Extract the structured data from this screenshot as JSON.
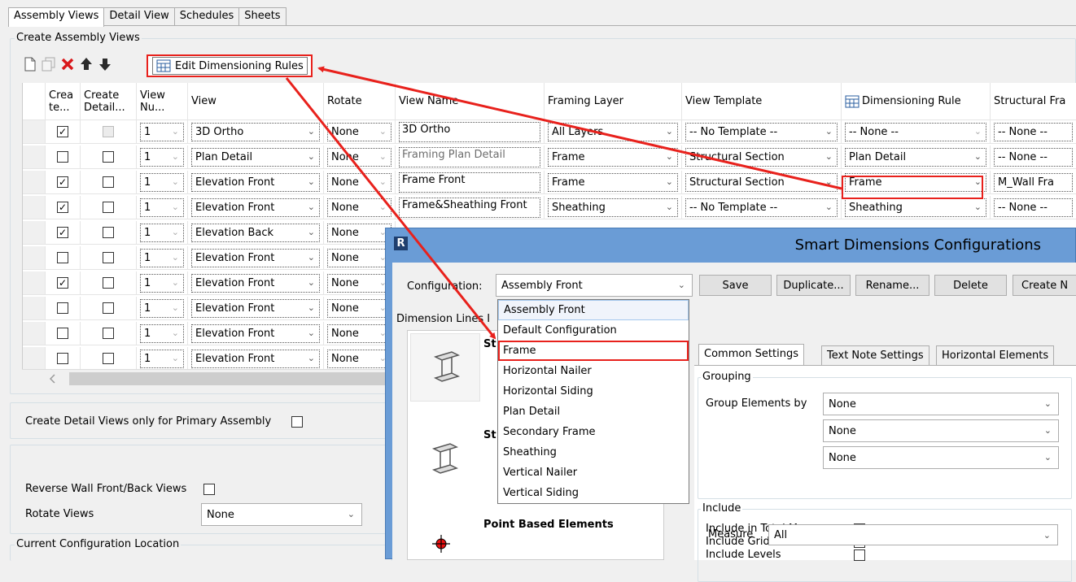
{
  "tabs": [
    "Assembly Views",
    "Detail View",
    "Schedules",
    "Sheets"
  ],
  "groups": {
    "create_assembly_views": "Create Assembly Views",
    "current_configuration_location": "Current Configuration Location"
  },
  "toolbar": {
    "edit_dimensioning_rules": "Edit Dimensioning Rules"
  },
  "grid": {
    "headers": {
      "create": "Crea te...",
      "create_detail": "Create Detail...",
      "view_number": "View Nu...",
      "view": "View",
      "rotate": "Rotate",
      "view_name": "View Name",
      "framing_layer": "Framing Layer",
      "view_template": "View Template",
      "dimensioning_rule": "Dimensioning Rule",
      "structural_framing": "Structural Fra"
    },
    "rows": [
      {
        "create": true,
        "create_detail": "disabled",
        "num": "1",
        "view": "3D Ortho",
        "rotate": "None",
        "view_name": "3D Ortho",
        "name_gray": false,
        "layer": "All Layers",
        "template": "-- No Template --",
        "rule": "-- None --",
        "rule_dis": true,
        "struct": "-- None --"
      },
      {
        "create": false,
        "create_detail": false,
        "num": "1",
        "view": "Plan Detail",
        "rotate": "None",
        "view_name": "Framing Plan Detail",
        "name_gray": true,
        "layer": "Frame",
        "template": "Structural Section",
        "rule": "Plan Detail",
        "rule_dis": false,
        "struct": "-- None --"
      },
      {
        "create": true,
        "create_detail": false,
        "num": "1",
        "view": "Elevation Front",
        "rotate": "None",
        "view_name": "Frame Front",
        "name_gray": false,
        "layer": "Frame",
        "template": "Structural Section",
        "rule": "Frame",
        "rule_dis": false,
        "struct": "M_Wall Fra"
      },
      {
        "create": true,
        "create_detail": false,
        "num": "1",
        "view": "Elevation Front",
        "rotate": "None",
        "view_name": "Frame&Sheathing Front",
        "name_gray": false,
        "layer": "Sheathing",
        "template": "-- No Template --",
        "rule": "Sheathing",
        "rule_dis": false,
        "struct": "-- None --"
      },
      {
        "create": true,
        "create_detail": false,
        "num": "1",
        "view": "Elevation Back",
        "rotate": "None"
      },
      {
        "create": false,
        "create_detail": false,
        "num": "1",
        "view": "Elevation Front",
        "rotate": "None"
      },
      {
        "create": true,
        "create_detail": false,
        "num": "1",
        "view": "Elevation Front",
        "rotate": "None"
      },
      {
        "create": false,
        "create_detail": false,
        "num": "1",
        "view": "Elevation Front",
        "rotate": "None"
      },
      {
        "create": false,
        "create_detail": false,
        "num": "1",
        "view": "Elevation Front",
        "rotate": "None"
      },
      {
        "create": false,
        "create_detail": false,
        "num": "1",
        "view": "Elevation Front",
        "rotate": "None"
      }
    ]
  },
  "options": {
    "primary_assembly_label": "Create Detail Views only for Primary Assembly",
    "reverse_label": "Reverse Wall Front/Back Views",
    "rotate_views_label": "Rotate Views",
    "rotate_views_value": "None"
  },
  "dialog": {
    "title": "Smart Dimensions Configurations",
    "configuration_label": "Configuration:",
    "configuration_value": "Assembly Front",
    "buttons": {
      "save": "Save",
      "duplicate": "Duplicate...",
      "rename": "Rename...",
      "delete": "Delete",
      "create": "Create N"
    },
    "dropdown_items": [
      "Assembly Front",
      "Default Configuration",
      "Frame",
      "Horizontal Nailer",
      "Horizontal Siding",
      "Plan Detail",
      "Secondary Frame",
      "Sheathing",
      "Vertical Nailer",
      "Vertical Siding"
    ],
    "dimension_lines_label": "Dimension Lines I",
    "left_panel": {
      "item1_label": "St",
      "item2_label": "St",
      "item3_label": "Point Based Elements"
    },
    "subtabs": [
      "Common Settings",
      "Text Note Settings",
      "Horizontal Elements"
    ],
    "grouping": {
      "title": "Grouping",
      "group_by_label": "Group Elements by",
      "values": [
        "None",
        "None",
        "None"
      ]
    },
    "include": {
      "title": "Include",
      "total_measure": "Include in Total Measure",
      "grids": "Include Grids",
      "levels": "Include Levels",
      "measure_label": "Measure",
      "measure_value": "All"
    }
  },
  "colors": {
    "annotation_red": "#e8211c",
    "dialog_blue": "#6a9cd6"
  }
}
